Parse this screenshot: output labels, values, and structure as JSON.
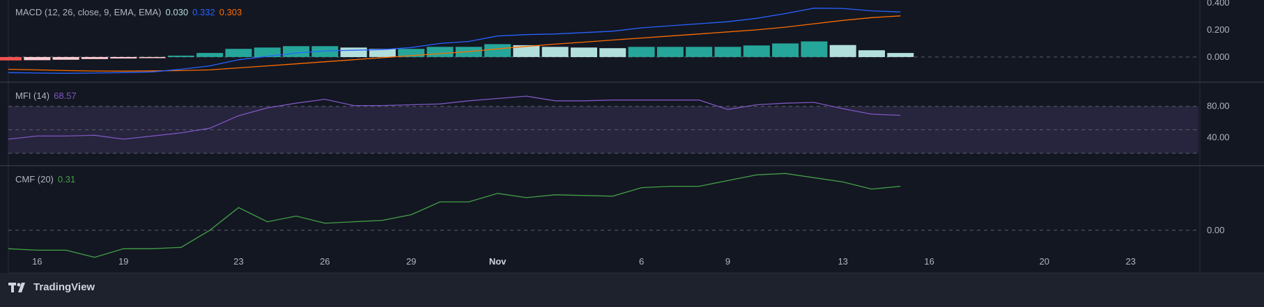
{
  "branding": {
    "logo_text": "TradingView"
  },
  "colors": {
    "bg": "#1e222d",
    "pane": "#131722",
    "grid": "#2a2e39",
    "text": "#b2b5be",
    "macd_line": "#2962ff",
    "signal_line": "#ff6d00",
    "hist_up_strong": "#26a69a",
    "hist_up_weak": "#b2dfdb",
    "hist_down_strong": "#ef5350",
    "hist_down_weak": "#ffcdd2",
    "mfi_line": "#7e57c2",
    "mfi_band": "#2a2640",
    "cmf_line": "#43a047"
  },
  "panes": {
    "macd": {
      "label": "MACD (12, 26, close, 9, EMA, EMA)",
      "v_hist": "0.030",
      "v_macd": "0.332",
      "v_signal": "0.303"
    },
    "mfi": {
      "label": "MFI (14)",
      "value": "68.57"
    },
    "cmf": {
      "label": "CMF (20)",
      "value": "0.31"
    }
  },
  "chart_data": [
    {
      "type": "line",
      "title": "MACD (12, 26, close, 9, EMA, EMA)",
      "x": [
        "Oct 15",
        "Oct 16",
        "Oct 17",
        "Oct 18",
        "Oct 19",
        "Oct 20",
        "Oct 21",
        "Oct 22",
        "Oct 23",
        "Oct 24",
        "Oct 25",
        "Oct 26",
        "Oct 27",
        "Oct 28",
        "Oct 29",
        "Oct 30",
        "Oct 31",
        "Nov 1",
        "Nov 2",
        "Nov 3",
        "Nov 4",
        "Nov 5",
        "Nov 6",
        "Nov 7",
        "Nov 8",
        "Nov 9",
        "Nov 10",
        "Nov 11",
        "Nov 12",
        "Nov 13",
        "Nov 14",
        "Nov 15"
      ],
      "y_ticks": [
        "0.000",
        "0.200",
        "0.400"
      ],
      "ylim": [
        -0.18,
        0.42
      ],
      "series": [
        {
          "name": "MACD",
          "values": [
            -0.115,
            -0.118,
            -0.12,
            -0.118,
            -0.115,
            -0.11,
            -0.09,
            -0.065,
            -0.02,
            0.005,
            0.03,
            0.045,
            0.05,
            0.055,
            0.07,
            0.1,
            0.115,
            0.155,
            0.165,
            0.17,
            0.18,
            0.19,
            0.215,
            0.23,
            0.245,
            0.26,
            0.285,
            0.32,
            0.36,
            0.358,
            0.34,
            0.332
          ]
        },
        {
          "name": "Signal",
          "values": [
            -0.09,
            -0.095,
            -0.1,
            -0.103,
            -0.104,
            -0.102,
            -0.1,
            -0.095,
            -0.08,
            -0.065,
            -0.05,
            -0.035,
            -0.02,
            -0.005,
            0.01,
            0.025,
            0.04,
            0.06,
            0.078,
            0.095,
            0.11,
            0.125,
            0.14,
            0.155,
            0.17,
            0.185,
            0.2,
            0.22,
            0.245,
            0.27,
            0.29,
            0.303
          ]
        },
        {
          "name": "Histogram",
          "values": [
            -0.025,
            -0.023,
            -0.02,
            -0.015,
            -0.011,
            -0.008,
            0.01,
            0.03,
            0.06,
            0.07,
            0.08,
            0.08,
            0.07,
            0.06,
            0.06,
            0.075,
            0.075,
            0.095,
            0.087,
            0.075,
            0.07,
            0.065,
            0.075,
            0.075,
            0.075,
            0.075,
            0.085,
            0.1,
            0.115,
            0.088,
            0.05,
            0.03
          ]
        }
      ],
      "reference_lines": [
        0
      ]
    },
    {
      "type": "line",
      "title": "MFI (14)",
      "x": [
        "Oct 15",
        "Oct 16",
        "Oct 17",
        "Oct 18",
        "Oct 19",
        "Oct 20",
        "Oct 21",
        "Oct 22",
        "Oct 23",
        "Oct 24",
        "Oct 25",
        "Oct 26",
        "Oct 27",
        "Oct 28",
        "Oct 29",
        "Oct 30",
        "Oct 31",
        "Nov 1",
        "Nov 2",
        "Nov 3",
        "Nov 4",
        "Nov 5",
        "Nov 6",
        "Nov 7",
        "Nov 8",
        "Nov 9",
        "Nov 10",
        "Nov 11",
        "Nov 12",
        "Nov 13",
        "Nov 14",
        "Nov 15"
      ],
      "y_ticks": [
        "40.00",
        "80.00"
      ],
      "ylim": [
        5,
        110
      ],
      "band": [
        20,
        80
      ],
      "series": [
        {
          "name": "MFI",
          "values": [
            38,
            42,
            42,
            43,
            38,
            42,
            46,
            52,
            68,
            78,
            84,
            89,
            81,
            81,
            82,
            83,
            87,
            90,
            93,
            87,
            87,
            88,
            88,
            88,
            88,
            76,
            82,
            84,
            85,
            77,
            70,
            68.57
          ]
        }
      ]
    },
    {
      "type": "line",
      "title": "CMF (20)",
      "x": [
        "Oct 15",
        "Oct 16",
        "Oct 17",
        "Oct 18",
        "Oct 19",
        "Oct 20",
        "Oct 21",
        "Oct 22",
        "Oct 23",
        "Oct 24",
        "Oct 25",
        "Oct 26",
        "Oct 27",
        "Oct 28",
        "Oct 29",
        "Oct 30",
        "Oct 31",
        "Nov 1",
        "Nov 2",
        "Nov 3",
        "Nov 4",
        "Nov 5",
        "Nov 6",
        "Nov 7",
        "Nov 8",
        "Nov 9",
        "Nov 10",
        "Nov 11",
        "Nov 12",
        "Nov 13",
        "Nov 14",
        "Nov 15"
      ],
      "y_ticks": [
        "0.00"
      ],
      "ylim": [
        -0.3,
        0.45
      ],
      "series": [
        {
          "name": "CMF",
          "values": [
            -0.13,
            -0.14,
            -0.14,
            -0.19,
            -0.13,
            -0.13,
            -0.12,
            0.0,
            0.16,
            0.06,
            0.1,
            0.05,
            0.06,
            0.07,
            0.11,
            0.2,
            0.2,
            0.26,
            0.23,
            0.25,
            0.245,
            0.24,
            0.3,
            0.31,
            0.31,
            0.35,
            0.39,
            0.4,
            0.37,
            0.34,
            0.29,
            0.31
          ]
        }
      ],
      "reference_lines": [
        0
      ]
    }
  ],
  "x_axis": {
    "ticks": [
      "16",
      "19",
      "23",
      "26",
      "29",
      "Nov",
      "6",
      "9",
      "13",
      "16",
      "20",
      "23"
    ]
  }
}
